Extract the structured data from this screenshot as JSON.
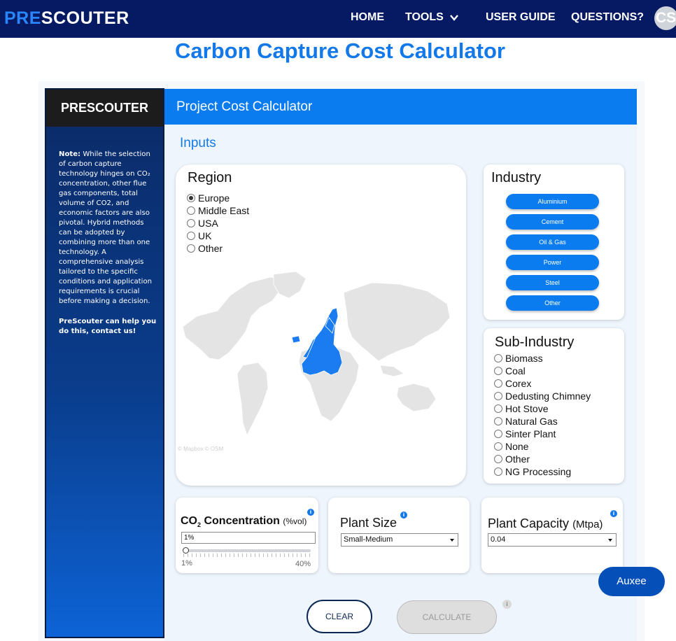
{
  "colors": {
    "nav_bg": "#061a63",
    "accent": "#0a7cf0",
    "title": "#1479e8"
  },
  "topbar": {
    "logo_pre": "PRE",
    "logo_rest": "SCOUTER",
    "nav": [
      "HOME",
      "TOOLS",
      "USER GUIDE",
      "QUESTIONS?"
    ],
    "avatar_initials": "CS"
  },
  "page_title": "Carbon Capture Cost Calculator",
  "sidebar": {
    "brand": "PRESCOUTER",
    "note_label": "Note:",
    "note_text": "While the selection of carbon capture technology hinges on CO₂ concentration, other flue gas components, total volume of CO2, and economic factors are also pivotal. Hybrid methods can be adopted by combining more than one technology. A comprehensive analysis tailored to the specific conditions and application requirements is crucial before making a decision.",
    "cta": "PreScouter can help you do this, contact us!"
  },
  "calculator": {
    "header": "Project Cost Calculator",
    "inputs_label": "Inputs",
    "region": {
      "title": "Region",
      "options": [
        "Europe",
        "Middle East",
        "USA",
        "UK",
        "Other"
      ],
      "selected": "Europe",
      "map_credit": "© Mapbox  © OSM",
      "highlight_color": "#1a7cf0"
    },
    "industry": {
      "title": "Industry",
      "options": [
        "Aluminium",
        "Cement",
        "Oil & Gas",
        "Power",
        "Steel",
        "Other"
      ]
    },
    "sub_industry": {
      "title": "Sub-Industry",
      "options": [
        "Biomass",
        "Coal",
        "Corex",
        "Dedusting Chimney",
        "Hot Stove",
        "Natural Gas",
        "Sinter Plant",
        "None",
        "Other",
        "NG Processing"
      ]
    },
    "co2": {
      "title_main": "CO",
      "title_sub": "2",
      "title_rest": " Concentration ",
      "unit": "(%vol)",
      "value": "1%",
      "min_label": "1%",
      "max_label": "40%",
      "slider_fraction": 0
    },
    "plant_size": {
      "title": "Plant Size",
      "selected": "Small-Medium"
    },
    "plant_capacity": {
      "title": "Plant Capacity ",
      "unit": "(Mtpa)",
      "selected": "0.04"
    },
    "buttons": {
      "clear": "CLEAR",
      "calculate": "CALCULATE"
    }
  },
  "assistant": {
    "label": "Auxee"
  }
}
